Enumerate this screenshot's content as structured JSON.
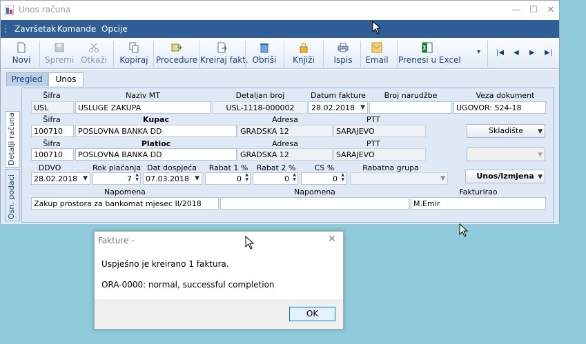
{
  "window": {
    "title": "Unos računa",
    "min": "—",
    "max": "☐",
    "close": "✕"
  },
  "menu": [
    "Završetak",
    "Komande",
    "Opcije"
  ],
  "toolbar": [
    {
      "label": "Novi",
      "icon": "new-doc-icon"
    },
    {
      "label": "Spremi",
      "icon": "save-icon"
    },
    {
      "label": "Otkaži",
      "icon": "scissors-icon"
    },
    {
      "label": "Kopiraj",
      "icon": "copy-icon"
    },
    {
      "label": "Procedure",
      "icon": "procedure-icon"
    },
    {
      "label": "Kreiraj fakt.",
      "icon": "create-invoice-icon"
    },
    {
      "label": "Obriši",
      "icon": "trash-icon"
    },
    {
      "label": "Knjiži",
      "icon": "lock-icon"
    },
    {
      "label": "Ispis",
      "icon": "printer-icon"
    },
    {
      "label": "Email",
      "icon": "email-icon"
    },
    {
      "label": "Prenesi u Excel",
      "icon": "excel-icon"
    }
  ],
  "toolbar_overflow": "▾",
  "nav": {
    "first": "|◀",
    "prev": "◀",
    "next": "▶",
    "last": "▶|"
  },
  "tabs": {
    "pregled": "Pregled",
    "unos": "Unos"
  },
  "side_tabs": {
    "detalji": "Detalji računa",
    "osn": "Osn. podaci"
  },
  "row1": {
    "sifra_label": "Šifra",
    "sifra": "USL",
    "naziv_label": "Naziv MT",
    "naziv": "USLUGE ZAKUPA",
    "detaljan_label": "Detaljan broj",
    "detaljan": "USL-1118-000002",
    "datum_label": "Datum fakture",
    "datum": "28.02.2018",
    "narudzba_label": "Broj narudžbe",
    "narudzba": "",
    "veza_label": "Veza dokument",
    "veza": "UGOVOR: 524-18"
  },
  "kupac": {
    "sifra_label": "Šifra",
    "sifra": "100710",
    "title": "Kupac",
    "naziv": "POSLOVNA BANKA DD",
    "adresa_label": "Adresa",
    "adresa": "GRADSKA 12",
    "ptt_label": "PTT",
    "ptt": "SARAJEVO"
  },
  "platioc": {
    "sifra_label": "Šifra",
    "sifra": "100710",
    "title": "Platioc",
    "naziv": "POSLOVNA BANKA DD",
    "adresa_label": "Adresa",
    "adresa": "GRADSKA 12",
    "ptt_label": "PTT",
    "ptt": "SARAJEVO"
  },
  "terms": {
    "ddvo_label": "DDVO",
    "ddvo": "28.02.2018",
    "rok_label": "Rok plaćanja",
    "rok": "7",
    "dospjeca_label": "Dat dospjeća",
    "dospjeca": "07.03.2018",
    "rabat1_label": "Rabat 1 %",
    "rabat1": "0",
    "rabat2_label": "Rabat 2 %",
    "rabat2": "0",
    "cs_label": "CS %",
    "cs": "0",
    "grupa_label": "Rabatna grupa",
    "grupa": ""
  },
  "buttons": {
    "skladiste": "Skladište",
    "empty_dd": "",
    "unos": "Unos/Izmjena"
  },
  "notes": {
    "napomena1_label": "Napomena",
    "napomena1": "Zakup prostora za bankomat  mjesec II/2018",
    "napomena2_label": "Napomena",
    "napomena2": "",
    "fakturirao_label": "Fakturirao",
    "fakturirao": "M.Emir"
  },
  "dialog": {
    "title": "Fakture -",
    "close": "✕",
    "message1": "Uspješno je kreirano 1 faktura.",
    "message2": "ORA-0000: normal, successful completion",
    "ok": "OK"
  },
  "colors": {
    "menubar": "#2f5e97",
    "panel": "#dfe9f5",
    "desktop": "#8fcbdb",
    "toolbar_text": "#1f3f7a"
  }
}
